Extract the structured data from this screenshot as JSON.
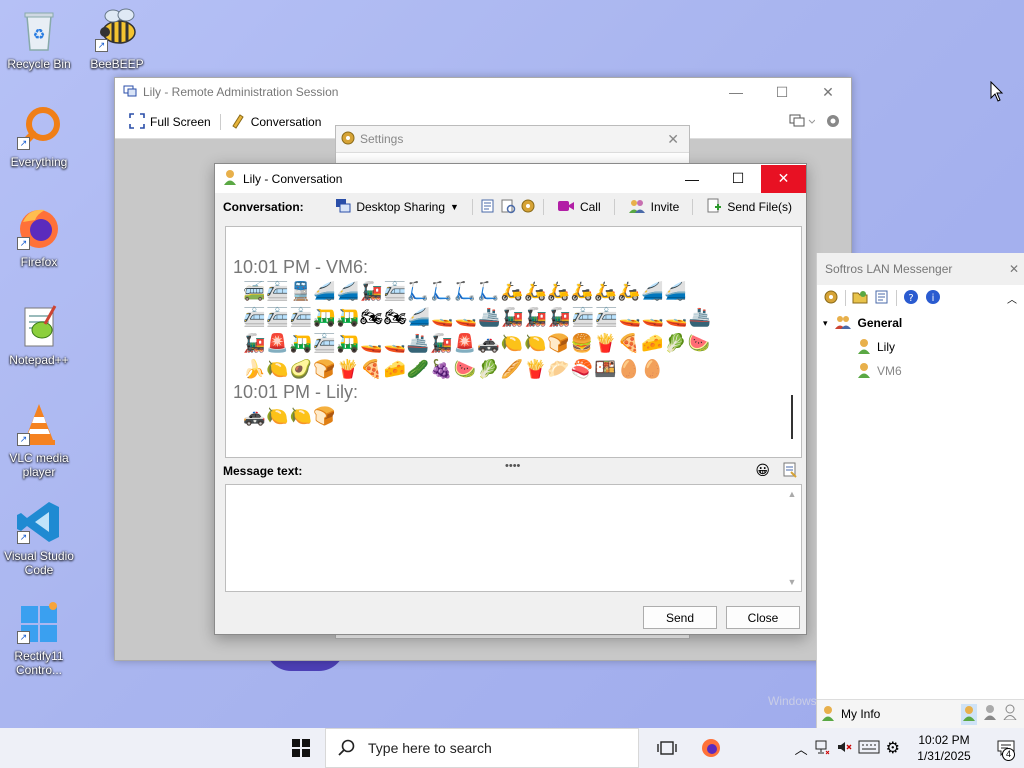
{
  "desktop": {
    "icons": [
      {
        "label": "Recycle Bin"
      },
      {
        "label": "BeeBEEP"
      },
      {
        "label": "Everything"
      },
      {
        "label": "Firefox"
      },
      {
        "label": "Notepad++"
      },
      {
        "label": "VLC media player"
      },
      {
        "label": "Visual Studio Code"
      },
      {
        "label": "Rectify11 Contro..."
      }
    ],
    "watermark": "Windows"
  },
  "remote_window": {
    "title": "Lily - Remote Administration Session",
    "toolbar": {
      "full_screen": "Full Screen",
      "conversation": "Conversation"
    }
  },
  "settings_window": {
    "title": "Settings"
  },
  "conversation_window": {
    "title": "Lily - Conversation",
    "toolbar": {
      "label": "Conversation:",
      "desktop_sharing": "Desktop Sharing",
      "call": "Call",
      "invite": "Invite",
      "send_files": "Send File(s)"
    },
    "messages": [
      {
        "header": "10:01 PM - VM6:",
        "rows": [
          "🚎🚈🚆🚄🚄🚂🚈🛴🛴🛴🛴🛵🛵🛵🛵🛵🛵🚄🚄",
          "🚈🚈🚈🛺🛺🏍🏍🚄🚤🚤🚢🚂🚂🚂🚈🚈🚤🚤🚤🚢",
          "🚂🚨🛺🚈🛺🚤🚤🚢🚂🚨🚓🍋🍋🍞🍔🍟🍕🧀🥬🍉",
          "🍌🍋🥑🍞🍟🍕🧀🥒🍇🍉🥬🥖🍟🥟🍣🍱🥚🥚"
        ]
      },
      {
        "header": "10:01 PM - Lily:",
        "rows": [
          "🚓🍋🍋🍞"
        ]
      }
    ],
    "message_label": "Message text:",
    "message_value": "",
    "send_label": "Send",
    "close_label": "Close"
  },
  "softros": {
    "title": "Softros LAN Messenger",
    "group": "General",
    "users": [
      {
        "name": "Lily",
        "online": true
      },
      {
        "name": "VM6",
        "online": false
      }
    ],
    "my_info": "My Info"
  },
  "taskbar": {
    "search_placeholder": "Type here to search",
    "time": "10:02 PM",
    "date": "1/31/2025",
    "notification_count": "4"
  }
}
